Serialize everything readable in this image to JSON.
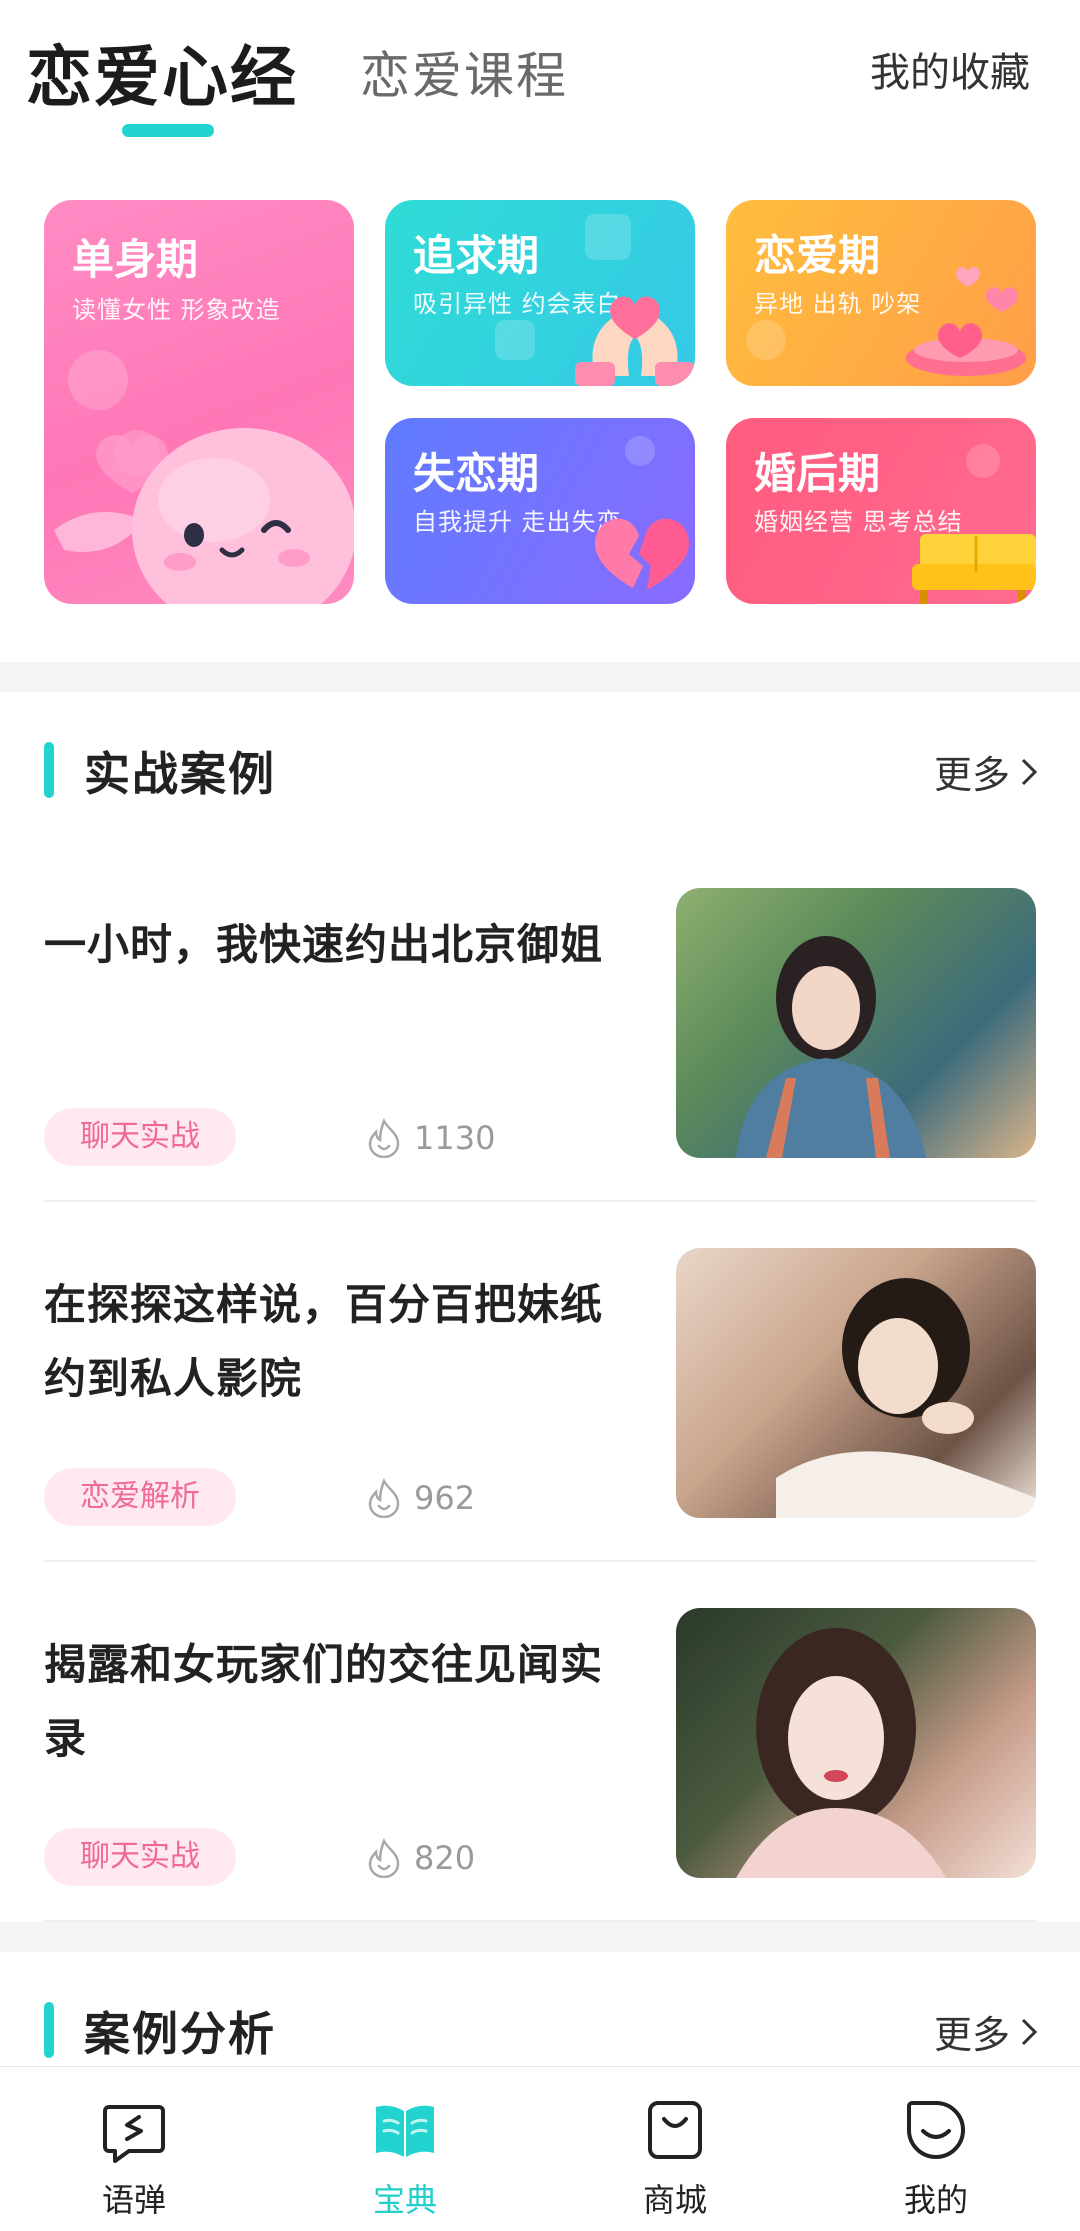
{
  "header": {
    "tab_active": "恋爱心经",
    "tab_second": "恋爱课程",
    "favorites": "我的收藏"
  },
  "categories": [
    {
      "title": "单身期",
      "subtitle": "读懂女性 形象改造"
    },
    {
      "title": "追求期",
      "subtitle": "吸引异性 约会表白"
    },
    {
      "title": "恋爱期",
      "subtitle": "异地 出轨 吵架"
    },
    {
      "title": "失恋期",
      "subtitle": "自我提升 走出失恋"
    },
    {
      "title": "婚后期",
      "subtitle": "婚姻经营 思考总结"
    }
  ],
  "section_cases": {
    "title": "实战案例",
    "more": "更多",
    "articles": [
      {
        "title": "一小时，我快速约出北京御姐",
        "tag": "聊天实战",
        "views": "1130"
      },
      {
        "title": "在探探这样说，百分百把妹纸约到私人影院",
        "tag": "恋爱解析",
        "views": "962"
      },
      {
        "title": "揭露和女玩家们的交往见闻实录",
        "tag": "聊天实战",
        "views": "820"
      }
    ]
  },
  "section_analysis": {
    "title": "案例分析",
    "more": "更多"
  },
  "bottom_nav": [
    {
      "label": "语弹",
      "icon": "chat-bubble-icon",
      "active": false
    },
    {
      "label": "宝典",
      "icon": "book-icon",
      "active": true
    },
    {
      "label": "商城",
      "icon": "shopping-bag-icon",
      "active": false
    },
    {
      "label": "我的",
      "icon": "smile-face-icon",
      "active": false
    }
  ],
  "colors": {
    "accent": "#23d3cf",
    "tag_bg": "#ffe9ef",
    "tag_text": "#ef6a94"
  }
}
